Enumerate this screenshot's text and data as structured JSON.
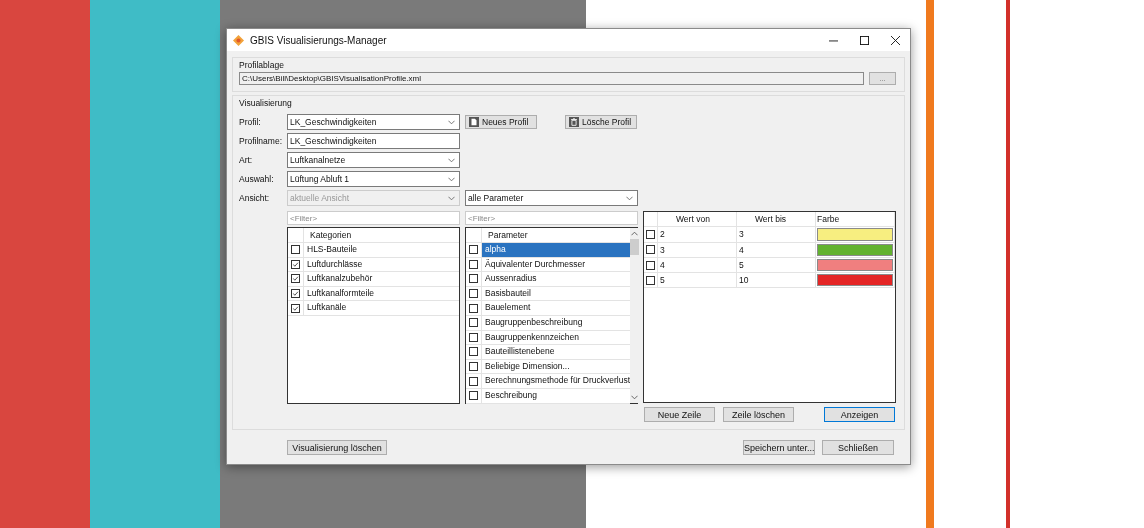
{
  "window": {
    "title": "GBIS Visualisierungs-Manager"
  },
  "profilablage": {
    "legend": "Profilablage",
    "path": "C:\\Users\\Bill\\Desktop\\GBISVisualisationProfile.xml",
    "browse_button": "..."
  },
  "visualisierung": {
    "legend": "Visualisierung",
    "fields": [
      {
        "label": "Profil:",
        "kind": "combo",
        "value": "LK_Geschwindigkeiten",
        "disabled": false
      },
      {
        "label": "Profilname:",
        "kind": "text",
        "value": "LK_Geschwindigkeiten",
        "disabled": false
      },
      {
        "label": "Art:",
        "kind": "combo",
        "value": "Luftkanalnetze",
        "disabled": false
      },
      {
        "label": "Auswahl:",
        "kind": "combo",
        "value": "Lüftung Abluft 1",
        "disabled": false
      },
      {
        "label": "Ansicht:",
        "kind": "combo",
        "value": "aktuelle Ansicht",
        "disabled": true
      }
    ],
    "profile_buttons": [
      "Neues Profil",
      "Lösche Profil"
    ],
    "parameter_scope": {
      "value": "alle Parameter"
    },
    "categories": {
      "filter_placeholder": "<Filter>",
      "header": "Kategorien",
      "items": [
        {
          "label": "HLS-Bauteile",
          "checked": false
        },
        {
          "label": "Luftdurchlässe",
          "checked": true
        },
        {
          "label": "Luftkanalzubehör",
          "checked": true
        },
        {
          "label": "Luftkanalformteile",
          "checked": true
        },
        {
          "label": "Luftkanäle",
          "checked": true
        }
      ]
    },
    "parameters": {
      "filter_placeholder": "<Filter>",
      "header": "Parameter",
      "items": [
        {
          "label": "alpha",
          "checked": false,
          "selected": true
        },
        {
          "label": "Äquivalenter Durchmesser",
          "checked": false,
          "selected": false
        },
        {
          "label": "Aussenradius",
          "checked": false,
          "selected": false
        },
        {
          "label": "Basisbauteil",
          "checked": false,
          "selected": false
        },
        {
          "label": "Bauelement",
          "checked": false,
          "selected": false
        },
        {
          "label": "Baugruppenbeschreibung",
          "checked": false,
          "selected": false
        },
        {
          "label": "Baugruppenkennzeichen",
          "checked": false,
          "selected": false
        },
        {
          "label": "Bauteillistenebene",
          "checked": false,
          "selected": false
        },
        {
          "label": "Beliebige Dimension...",
          "checked": false,
          "selected": false
        },
        {
          "label": "Berechnungsmethode für Druckverlust",
          "checked": false,
          "selected": false
        },
        {
          "label": "Beschreibung",
          "checked": false,
          "selected": false
        }
      ]
    },
    "ranges": {
      "columns": [
        "Wert von",
        "Wert bis",
        "Farbe"
      ],
      "rows": [
        {
          "checked": false,
          "from": "2",
          "to": "3",
          "color": "#f7ee80"
        },
        {
          "checked": false,
          "from": "3",
          "to": "4",
          "color": "#62b22f"
        },
        {
          "checked": false,
          "from": "4",
          "to": "5",
          "color": "#f07f7f"
        },
        {
          "checked": false,
          "from": "5",
          "to": "10",
          "color": "#e42525"
        }
      ],
      "buttons": [
        "Neue Zeile",
        "Zeile löschen",
        "Anzeigen"
      ]
    }
  },
  "footer": {
    "left_button": "Visualisierung löschen",
    "right_buttons": [
      "Speichern unter...",
      "Schließen"
    ]
  }
}
